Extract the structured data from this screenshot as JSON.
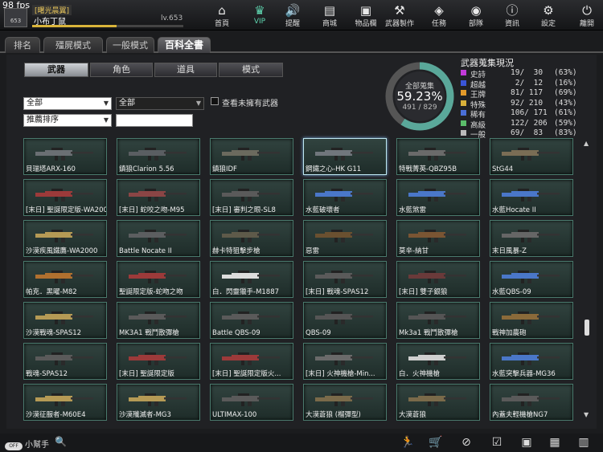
{
  "fps": "98 fps",
  "player": {
    "guild": "[曙光晨翼]",
    "name": "小布丁鼠",
    "level": "lv.653",
    "avatar_text": "653",
    "xp_fraction": 0.56
  },
  "nav": [
    {
      "label": "首頁",
      "icon": "home-icon",
      "glyph": "⌂"
    },
    {
      "label": "VIP",
      "icon": "crown-icon",
      "glyph": "♛"
    },
    {
      "label": "提醒",
      "icon": "speaker-icon",
      "glyph": "🔊"
    },
    {
      "label": "商城",
      "icon": "shop-icon",
      "glyph": "▤"
    },
    {
      "label": "物品欄",
      "icon": "bag-icon",
      "glyph": "▣"
    },
    {
      "label": "武器製作",
      "icon": "gun-craft-icon",
      "glyph": "⚒"
    },
    {
      "label": "任務",
      "icon": "ticket-icon",
      "glyph": "◈"
    },
    {
      "label": "部隊",
      "icon": "shield-icon",
      "glyph": "◉"
    },
    {
      "label": "資訊",
      "icon": "info-icon",
      "glyph": "ⓘ"
    },
    {
      "label": "設定",
      "icon": "gear-icon",
      "glyph": "⚙"
    },
    {
      "label": "離開",
      "icon": "power-icon",
      "glyph": "⏻"
    }
  ],
  "main_tabs": [
    "排名",
    "殭屍模式",
    "一般模式",
    "百科全書"
  ],
  "sub_tabs": [
    "武器",
    "角色",
    "道具",
    "模式"
  ],
  "filters": {
    "category": "全部",
    "subcategory": "全部",
    "sort": "推薦排序",
    "search": "",
    "only_missing_label": "查看未擁有武器"
  },
  "donut": {
    "title": "全部蒐集",
    "percent": "59.23%",
    "count": "491 / 829",
    "fraction": 0.5923
  },
  "collection": {
    "title": "武器蒐集現況",
    "rows": [
      {
        "name": "史詩",
        "count": "19/  30",
        "pct": "(63%)",
        "color": "#c23ad8"
      },
      {
        "name": "超越",
        "count": " 2/  12",
        "pct": "(16%)",
        "color": "#3a55d8"
      },
      {
        "name": "王牌",
        "count": "81/ 117",
        "pct": "(69%)",
        "color": "#e39a2b"
      },
      {
        "name": "特殊",
        "count": "92/ 210",
        "pct": "(43%)",
        "color": "#d8b03a"
      },
      {
        "name": "稀有",
        "count": "106/ 171",
        "pct": "(61%)",
        "color": "#4a6fd8"
      },
      {
        "name": "高級",
        "count": "122/ 206",
        "pct": "(59%)",
        "color": "#5bbd6a"
      },
      {
        "name": "一般",
        "count": "69/  83",
        "pct": "(83%)",
        "color": "#bbbbbb"
      }
    ]
  },
  "weapons": [
    {
      "name": "貝瑞塔ARX-160",
      "color": "#6a6f73"
    },
    {
      "name": "鎮狼Clarion 5.56",
      "color": "#5a5e62"
    },
    {
      "name": "鎮狼IDF",
      "color": "#6b6a5e"
    },
    {
      "name": "鋼鐵之心-HK G11",
      "color": "#70767c"
    },
    {
      "name": "特戰菁英-QBZ95B",
      "color": "#6a6a6a"
    },
    {
      "name": "StG44",
      "color": "#7a6d55"
    },
    {
      "name": "[末日] 聖誕限定版-WA2000",
      "color": "#9c3a3a"
    },
    {
      "name": "[末日] 蛇咬之吻-M95",
      "color": "#8a4545"
    },
    {
      "name": "[末日] 審判之眼-SL8",
      "color": "#5a5a5a"
    },
    {
      "name": "水藍破壞者",
      "color": "#4a77c8"
    },
    {
      "name": "水藍煞雷",
      "color": "#4a77c8"
    },
    {
      "name": "水藍Hocate II",
      "color": "#4a77c8"
    },
    {
      "name": "沙漠疾風鐵鷹-WA2000",
      "color": "#b59a55"
    },
    {
      "name": "Battle Nocate II",
      "color": "#5c5e60"
    },
    {
      "name": "赫卡特狙擊步槍",
      "color": "#5e5a4a"
    },
    {
      "name": "惡雷",
      "color": "#6a5030"
    },
    {
      "name": "莫辛-納甘",
      "color": "#7a5533"
    },
    {
      "name": "末日風暴-Z",
      "color": "#666"
    },
    {
      "name": "帕克．黑曜-M82",
      "color": "#b0702f"
    },
    {
      "name": "聖誕限定版-蛇吻之吻",
      "color": "#9c3a3a"
    },
    {
      "name": "白．閃靈獵手-M1887",
      "color": "#dddddd"
    },
    {
      "name": "[末日] 戰魂-SPAS12",
      "color": "#5a5a5a"
    },
    {
      "name": "[末日] 雙子銀狼",
      "color": "#6a3a3a"
    },
    {
      "name": "水藍QBS-09",
      "color": "#4a77c8"
    },
    {
      "name": "沙漠戰魂-SPAS12",
      "color": "#b59a55"
    },
    {
      "name": "MK3A1 戰鬥散彈槍",
      "color": "#5a5a5a"
    },
    {
      "name": "Battle QBS-09",
      "color": "#5a5a5a"
    },
    {
      "name": "QBS-09",
      "color": "#555"
    },
    {
      "name": "Mk3a1 戰鬥散彈槍",
      "color": "#555"
    },
    {
      "name": "戰神加農砲",
      "color": "#8a6a3a"
    },
    {
      "name": "戰魂-SPAS12",
      "color": "#5a5a5a"
    },
    {
      "name": "[末日] 聖誕限定版",
      "color": "#9c3a3a"
    },
    {
      "name": "[末日] 聖誕限定版火...",
      "color": "#9c3a3a"
    },
    {
      "name": "[末日] 火神機槍-Min...",
      "color": "#6a6a6a"
    },
    {
      "name": "白．火神機槍",
      "color": "#cfcfcf"
    },
    {
      "name": "水藍突擊兵器-MG36",
      "color": "#4a77c8"
    },
    {
      "name": "沙漠征服者-M60E4",
      "color": "#b59a55"
    },
    {
      "name": "沙漠殲滅者-MG3",
      "color": "#b59a55"
    },
    {
      "name": "ULTIMAX-100",
      "color": "#5a5a5a"
    },
    {
      "name": "大漠蒼狼 (榴彈型)",
      "color": "#7a6a4a"
    },
    {
      "name": "大漠蒼狼",
      "color": "#7a6a4a"
    },
    {
      "name": "內蓋夫輕機槍NG7",
      "color": "#5a5a5a"
    }
  ],
  "helper_label": "小幫手",
  "helper_pill": "OFF",
  "bottom_icons": [
    "runner-icon",
    "cart-icon",
    "compass-icon",
    "checklist-icon",
    "notebook-icon",
    "calendar-icon",
    "film-icon"
  ]
}
